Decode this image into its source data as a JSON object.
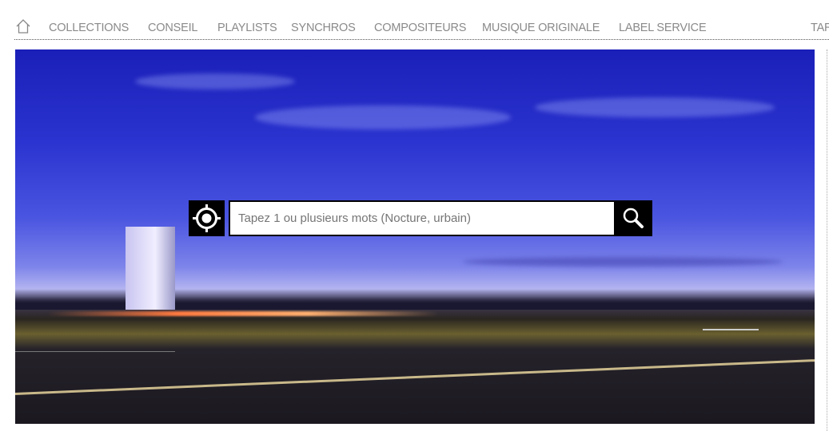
{
  "nav": {
    "home_icon": "home-icon",
    "items": [
      {
        "label": "COLLECTIONS"
      },
      {
        "label": "CONSEIL"
      },
      {
        "label": "PLAYLISTS"
      },
      {
        "label": "SYNCHROS"
      },
      {
        "label": "COMPOSITEURS"
      },
      {
        "label": "MUSIQUE ORIGINALE"
      },
      {
        "label": "LABEL SERVICE"
      },
      {
        "label": "TAR"
      }
    ],
    "text_color": "#8a8a8a"
  },
  "search": {
    "placeholder": "Tapez 1 ou plusieurs mots (Nocture, urbain)",
    "value": "",
    "locate_icon": "target-icon",
    "search_icon": "magnifier-icon"
  }
}
